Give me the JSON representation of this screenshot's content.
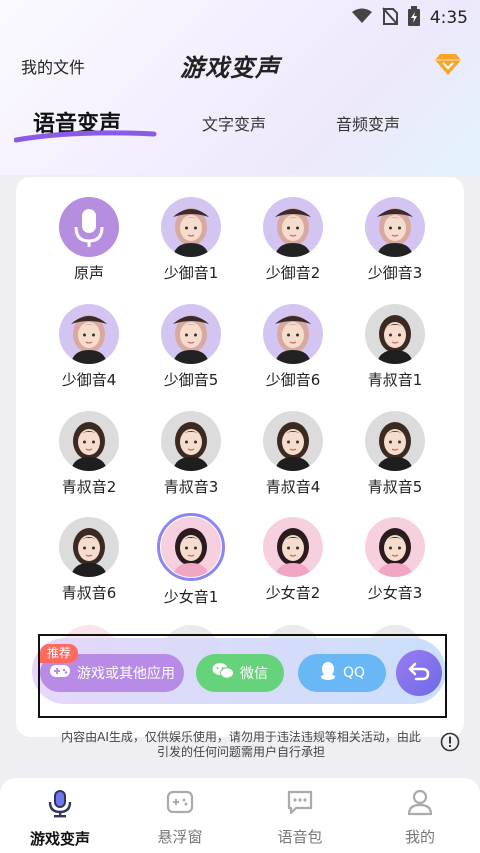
{
  "status_bar": {
    "time": "4:35"
  },
  "header": {
    "my_files": "我的文件",
    "title": "游戏变声"
  },
  "tabs": [
    {
      "label": "语音变声",
      "active": true
    },
    {
      "label": "文字变声",
      "active": false
    },
    {
      "label": "音频变声",
      "active": false
    }
  ],
  "voices": [
    {
      "label": "原声",
      "type": "mic"
    },
    {
      "label": "少御音1",
      "type": "purple"
    },
    {
      "label": "少御音2",
      "type": "purple"
    },
    {
      "label": "少御音3",
      "type": "purple"
    },
    {
      "label": "少御音4",
      "type": "purple"
    },
    {
      "label": "少御音5",
      "type": "purple"
    },
    {
      "label": "少御音6",
      "type": "purple"
    },
    {
      "label": "青叔音1",
      "type": "grey"
    },
    {
      "label": "青叔音2",
      "type": "grey"
    },
    {
      "label": "青叔音3",
      "type": "grey"
    },
    {
      "label": "青叔音4",
      "type": "grey"
    },
    {
      "label": "青叔音5",
      "type": "grey"
    },
    {
      "label": "青叔音6",
      "type": "grey"
    },
    {
      "label": "少女音1",
      "type": "pink",
      "selected": true
    },
    {
      "label": "少女音2",
      "type": "pink"
    },
    {
      "label": "少女音3",
      "type": "pink"
    }
  ],
  "action_bar": {
    "badge": "推荐",
    "game_label": "游戏或其他应用",
    "wechat_label": "微信",
    "qq_label": "QQ"
  },
  "disclaimer": "内容由AI生成，仅供娱乐使用，请勿用于违法违规等相关活动，由此引发的任何问题需用户自行承担",
  "bottom_nav": [
    {
      "label": "游戏变声",
      "active": true,
      "icon": "mic-icon"
    },
    {
      "label": "悬浮窗",
      "active": false,
      "icon": "gamepad-icon"
    },
    {
      "label": "语音包",
      "active": false,
      "icon": "chat-bubble-icon"
    },
    {
      "label": "我的",
      "active": false,
      "icon": "person-icon"
    }
  ],
  "colors": {
    "accent": "#8a6cf0",
    "wechat": "#66d27a",
    "qq": "#6ab7f5",
    "badge": "#ff6a5f"
  }
}
